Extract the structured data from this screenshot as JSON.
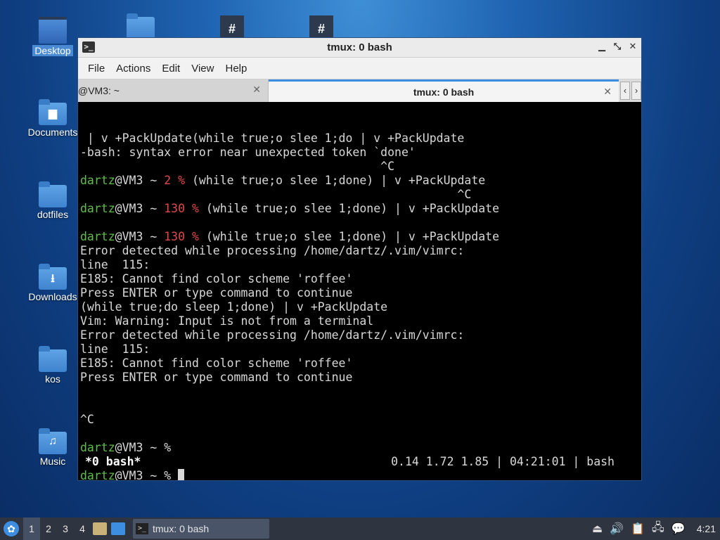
{
  "desktop": {
    "icons": [
      {
        "label": "Desktop",
        "icon": "desktop-icon"
      },
      {
        "label": "Documents",
        "icon": "folder-documents-icon"
      },
      {
        "label": "dotfiles",
        "icon": "folder-icon"
      },
      {
        "label": "Downloads",
        "icon": "folder-download-icon"
      },
      {
        "label": "kos",
        "icon": "folder-icon"
      },
      {
        "label": "Music",
        "icon": "folder-music-icon"
      }
    ]
  },
  "window": {
    "title": "tmux: 0 bash",
    "menu": [
      "File",
      "Actions",
      "Edit",
      "View",
      "Help"
    ],
    "tabs": [
      {
        "label": "@VM3: ~",
        "active": false
      },
      {
        "label": "tmux: 0 bash",
        "active": true
      }
    ],
    "terminal": {
      "lines": [
        [
          {
            "t": " | v +PackUpdate(while true;o slee 1;do | v +PackUpdate"
          }
        ],
        [
          {
            "t": "-bash: syntax error near unexpected token `done'"
          }
        ],
        [
          {
            "t": "                                           ^C"
          }
        ],
        [
          {
            "t": "dartz",
            "c": "g"
          },
          {
            "t": "@VM3 ~ "
          },
          {
            "t": "2 %",
            "c": "r"
          },
          {
            "t": " (while true;o slee 1;done) | v +PackUpdate"
          }
        ],
        [
          {
            "t": "                                                      ^C"
          }
        ],
        [
          {
            "t": "dartz",
            "c": "g"
          },
          {
            "t": "@VM3 ~ "
          },
          {
            "t": "130 %",
            "c": "r"
          },
          {
            "t": " (while true;o slee 1;done) | v +PackUpdate"
          }
        ],
        [
          {
            "t": ""
          }
        ],
        [
          {
            "t": "dartz",
            "c": "g"
          },
          {
            "t": "@VM3 ~ "
          },
          {
            "t": "130 %",
            "c": "r"
          },
          {
            "t": " (while true;o slee 1;done) | v +PackUpdate"
          }
        ],
        [
          {
            "t": "Error detected while processing /home/dartz/.vim/vimrc:"
          }
        ],
        [
          {
            "t": "line  115:"
          }
        ],
        [
          {
            "t": "E185: Cannot find color scheme 'roffee'"
          }
        ],
        [
          {
            "t": "Press ENTER or type command to continue"
          }
        ],
        [
          {
            "t": "(while true;do sleep 1;done) | v +PackUpdate"
          }
        ],
        [
          {
            "t": "Vim: Warning: Input is not from a terminal"
          }
        ],
        [
          {
            "t": "Error detected while processing /home/dartz/.vim/vimrc:"
          }
        ],
        [
          {
            "t": "line  115:"
          }
        ],
        [
          {
            "t": "E185: Cannot find color scheme 'roffee'"
          }
        ],
        [
          {
            "t": "Press ENTER or type command to continue"
          }
        ],
        [
          {
            "t": ""
          }
        ],
        [
          {
            "t": ""
          }
        ],
        [
          {
            "t": "^C"
          }
        ],
        [
          {
            "t": ""
          }
        ],
        [
          {
            "t": "dartz",
            "c": "g"
          },
          {
            "t": "@VM3 ~ %"
          }
        ],
        [
          {
            "t": ""
          }
        ],
        [
          {
            "t": "dartz",
            "c": "g"
          },
          {
            "t": "@VM3 ~ % "
          },
          {
            "cursor": true
          }
        ]
      ],
      "status_left": "*0 bash*",
      "status_right": "0.14 1.72 1.85 | 04:21:01 | bash"
    }
  },
  "taskbar": {
    "workspaces": [
      "1",
      "2",
      "3",
      "4"
    ],
    "active_workspace": "1",
    "task_label": "tmux: 0 bash",
    "clock": "4:21"
  }
}
